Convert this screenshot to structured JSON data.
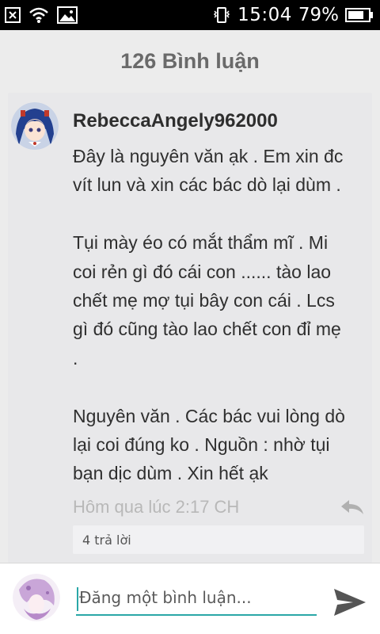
{
  "status_bar": {
    "time": "15:04",
    "battery_percent": "79%",
    "battery_level": 0.79,
    "left_icons": [
      "notification-x-icon",
      "wifi-icon",
      "image-icon"
    ],
    "right_icons": [
      "phone-vibrate-icon",
      "battery-icon"
    ]
  },
  "header": {
    "title": "126 Bình luận"
  },
  "comment": {
    "username": "RebeccaAngely962000",
    "lines": [
      "Đây là nguyên văn ạk . Em xin đc",
      "vít lun và xin các bác dò lại dùm .",
      "",
      "Tụi mày éo có mắt thẩm mĩ . Mi",
      "coi rẻn gì đó cái con ...... tào lao",
      "chết mẹ mợ tụi bây con cái . Lcs",
      "gì đó cũng tào lao chết con đỉ mẹ",
      ".",
      "",
      "Nguyên văn . Các bác vui lòng dò",
      "lại coi đúng ko . Nguồn : nhờ tụi",
      "bạn dịc dùm . Xin hết ạk"
    ],
    "timestamp": "Hôm qua lúc 2:17 CH",
    "replies_label": "4 trả lời"
  },
  "composer": {
    "placeholder": "Đăng một bình luận...",
    "value": ""
  },
  "colors": {
    "accent": "#2aa7a7",
    "background": "#ececec",
    "card": "#e8e8ea",
    "send_icon": "#555555"
  }
}
